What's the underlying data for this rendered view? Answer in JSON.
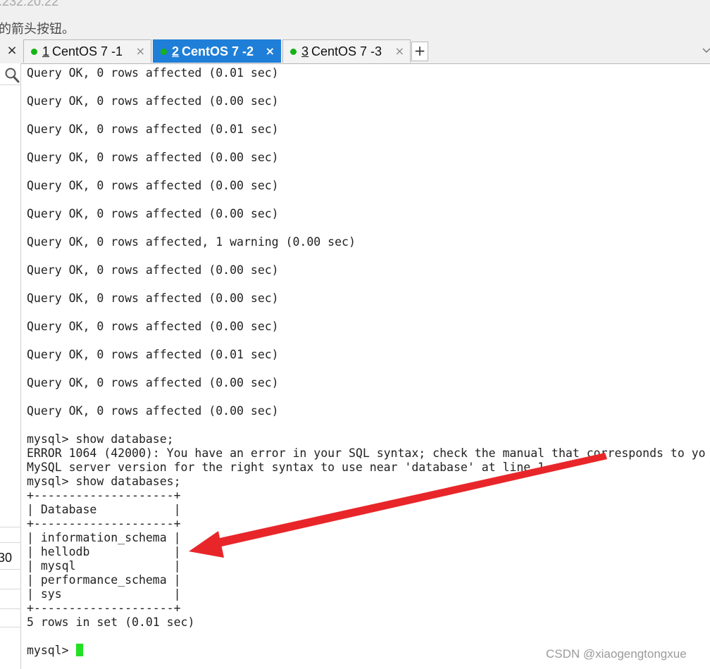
{
  "window": {
    "title_fragment": ".232.20.22",
    "hint_text": "的箭头按钮。"
  },
  "tabs": [
    {
      "number": "1",
      "label": " CentOS 7 -1",
      "active": false,
      "status": "green"
    },
    {
      "number": "2",
      "label": " CentOS 7 -2",
      "active": true,
      "status": "green"
    },
    {
      "number": "3",
      "label": " CentOS 7 -3",
      "active": false,
      "status": "green"
    }
  ],
  "tab_close_glyph": "×",
  "add_tab_glyph": "+",
  "close_panel_glyph": "×",
  "side_panel": {
    "partial_value": "30"
  },
  "terminal": {
    "lines": [
      "Query OK, 0 rows affected (0.01 sec)",
      "",
      "Query OK, 0 rows affected (0.00 sec)",
      "",
      "Query OK, 0 rows affected (0.01 sec)",
      "",
      "Query OK, 0 rows affected (0.00 sec)",
      "",
      "Query OK, 0 rows affected (0.00 sec)",
      "",
      "Query OK, 0 rows affected (0.00 sec)",
      "",
      "Query OK, 0 rows affected, 1 warning (0.00 sec)",
      "",
      "Query OK, 0 rows affected (0.00 sec)",
      "",
      "Query OK, 0 rows affected (0.00 sec)",
      "",
      "Query OK, 0 rows affected (0.00 sec)",
      "",
      "Query OK, 0 rows affected (0.01 sec)",
      "",
      "Query OK, 0 rows affected (0.00 sec)",
      "",
      "Query OK, 0 rows affected (0.00 sec)",
      "",
      "mysql> show database;",
      "ERROR 1064 (42000): You have an error in your SQL syntax; check the manual that corresponds to yo",
      "MySQL server version for the right syntax to use near 'database' at line 1",
      "mysql> show databases;",
      "+--------------------+",
      "| Database           |",
      "+--------------------+",
      "| information_schema |",
      "| hellodb            |",
      "| mysql              |",
      "| performance_schema |",
      "| sys                |",
      "+--------------------+",
      "5 rows in set (0.01 sec)",
      ""
    ],
    "prompt": "mysql> ",
    "cursor_color": "#22e022"
  },
  "annotation": {
    "arrow_color": "#e8262a"
  },
  "watermark": "CSDN @xiaogengtongxue",
  "colors": {
    "active_tab": "#1f7fd8",
    "status_dot": "#16b316"
  }
}
